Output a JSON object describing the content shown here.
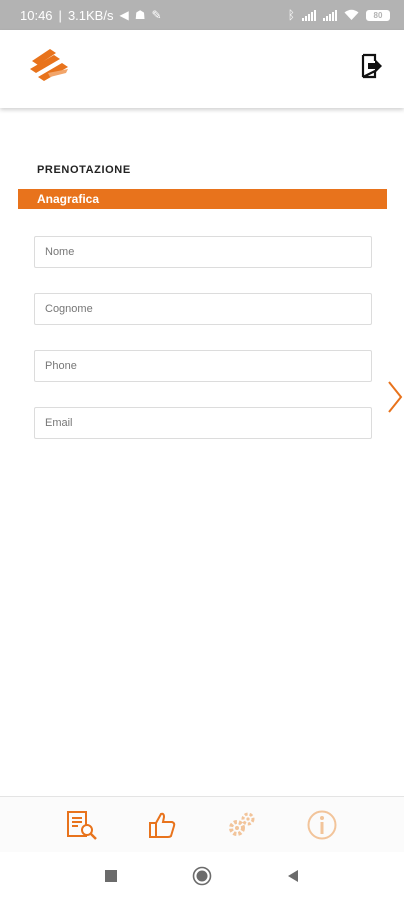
{
  "colors": {
    "accent": "#e8731c",
    "accent_faded": "#f2c49a",
    "status_bar": "#b3b3b3"
  },
  "status_bar": {
    "time": "10:46",
    "network_speed": "3.1KB/s",
    "battery": "80",
    "icons": [
      "telegram-icon",
      "mask-icon",
      "wrench-icon",
      "bluetooth-icon",
      "signal-icon",
      "signal-icon",
      "wifi-icon",
      "battery-icon"
    ]
  },
  "header": {
    "logo": "brand-logo",
    "logout_icon": "logout-icon"
  },
  "section": {
    "title": "PRENOTAZIONE",
    "subtitle": "Anagrafica"
  },
  "form": {
    "name_placeholder": "Nome",
    "surname_placeholder": "Cognome",
    "phone_placeholder": "Phone",
    "email_placeholder": "Email"
  },
  "navigation": {
    "next_icon": "chevron-right-icon"
  },
  "tabs": [
    {
      "icon": "document-search-icon",
      "state": "active"
    },
    {
      "icon": "thumbs-up-icon",
      "state": "active"
    },
    {
      "icon": "gears-icon",
      "state": "disabled"
    },
    {
      "icon": "info-icon",
      "state": "disabled"
    }
  ],
  "system_nav": {
    "icons": [
      "recents-square-icon",
      "home-circle-icon",
      "back-triangle-icon"
    ]
  }
}
